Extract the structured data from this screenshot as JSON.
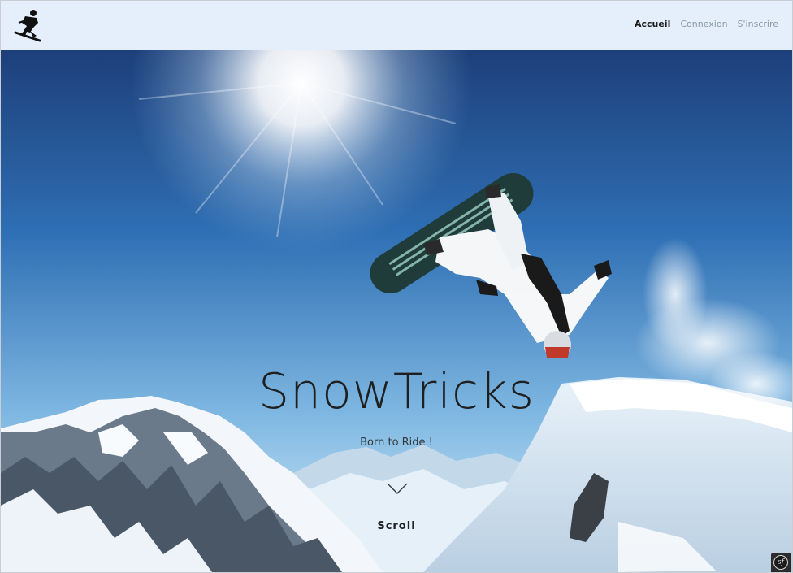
{
  "brand": {
    "logo_icon": "snowboarder-logo-icon"
  },
  "nav": {
    "items": [
      {
        "label": "Accueil",
        "active": true
      },
      {
        "label": "Connexion",
        "active": false
      },
      {
        "label": "S'inscrire",
        "active": false
      }
    ]
  },
  "hero": {
    "title": "SnowTricks",
    "subtitle": "Born to Ride !",
    "scroll_label": "Scroll",
    "scroll_icon": "chevron-down-icon"
  },
  "toolbar": {
    "symfony_badge": "sf"
  },
  "colors": {
    "sky_top": "#1d3f7a",
    "sky_bottom": "#bfe0f4",
    "snow": "#ffffff",
    "nav_bg": "#e4effb",
    "nav_active": "#1a1a1a",
    "nav_inactive": "#8a9aa8"
  }
}
